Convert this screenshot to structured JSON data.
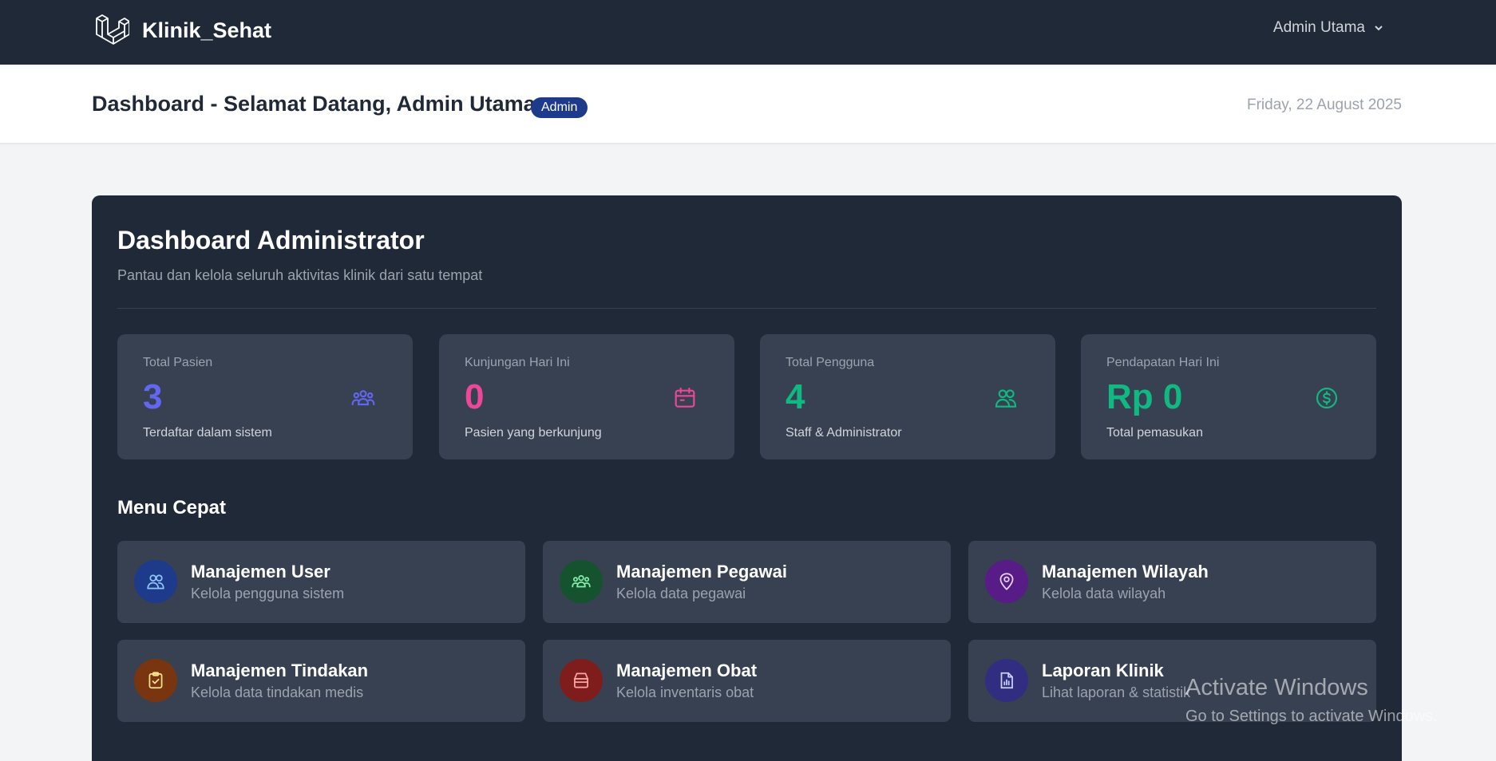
{
  "nav": {
    "brand": "Klinik_Sehat",
    "user": "Admin Utama"
  },
  "header": {
    "title": "Dashboard - Selamat Datang, Admin Utama",
    "badge": "Admin",
    "date": "Friday, 22 August 2025"
  },
  "panel": {
    "title": "Dashboard Administrator",
    "subtitle": "Pantau dan kelola seluruh aktivitas klinik dari satu tempat"
  },
  "stats": [
    {
      "label": "Total Pasien",
      "value": "3",
      "desc": "Terdaftar dalam sistem",
      "color": "#6366f1",
      "icon": "users-group-icon"
    },
    {
      "label": "Kunjungan Hari Ini",
      "value": "0",
      "desc": "Pasien yang berkunjung",
      "color": "#ec4899",
      "icon": "calendar-icon"
    },
    {
      "label": "Total Pengguna",
      "value": "4",
      "desc": "Staff & Administrator",
      "color": "#10b981",
      "icon": "users-icon"
    },
    {
      "label": "Pendapatan Hari Ini",
      "value": "Rp 0",
      "desc": "Total pemasukan",
      "color": "#10b981",
      "icon": "dollar-icon"
    }
  ],
  "quick_menu": {
    "title": "Menu Cepat",
    "items": [
      {
        "title": "Manajemen User",
        "desc": "Kelola pengguna sistem",
        "icon": "users-icon",
        "bg": "#1e3a8a",
        "fg": "#93c5fd"
      },
      {
        "title": "Manajemen Pegawai",
        "desc": "Kelola data pegawai",
        "icon": "users-group-icon",
        "bg": "#14532d",
        "fg": "#86efac"
      },
      {
        "title": "Manajemen Wilayah",
        "desc": "Kelola data wilayah",
        "icon": "location-pin-icon",
        "bg": "#581c87",
        "fg": "#e9d5ff"
      },
      {
        "title": "Manajemen Tindakan",
        "desc": "Kelola data tindakan medis",
        "icon": "clipboard-check-icon",
        "bg": "#78350f",
        "fg": "#fde68a"
      },
      {
        "title": "Manajemen Obat",
        "desc": "Kelola inventaris obat",
        "icon": "archive-box-icon",
        "bg": "#7f1d1d",
        "fg": "#fca5a5"
      },
      {
        "title": "Laporan Klinik",
        "desc": "Lihat laporan & statistik",
        "icon": "report-chart-icon",
        "bg": "#312e81",
        "fg": "#c7d2fe"
      }
    ]
  },
  "watermark": {
    "title": "Activate Windows",
    "sub": "Go to Settings to activate Windows."
  }
}
